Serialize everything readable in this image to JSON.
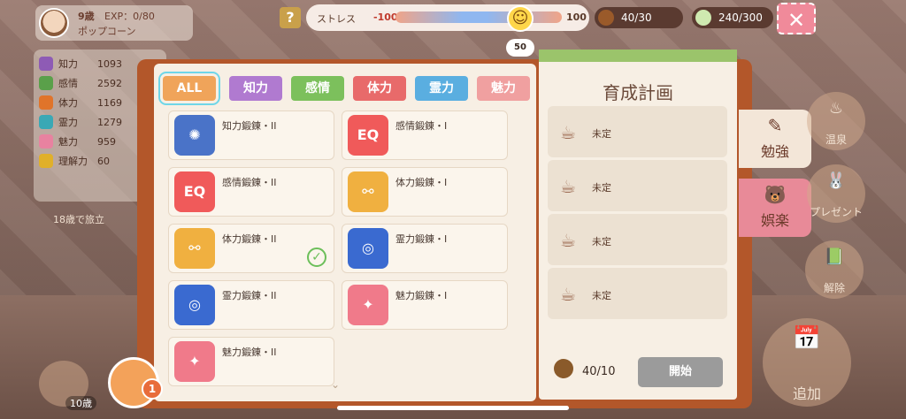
{
  "profile": {
    "age": "9歳",
    "exp": "EXP：0/80",
    "name": "ポップコーン"
  },
  "stats": [
    {
      "label": "知力",
      "value": "1093",
      "color": "#8e5bb5"
    },
    {
      "label": "感情",
      "value": "2592",
      "color": "#5aa04a"
    },
    {
      "label": "体力",
      "value": "1169",
      "color": "#e0742a"
    },
    {
      "label": "霊力",
      "value": "1279",
      "color": "#3aa8b5"
    },
    {
      "label": "魅力",
      "value": "959",
      "color": "#e882a0"
    },
    {
      "label": "理解力",
      "value": "60",
      "color": "#e0b02a"
    }
  ],
  "age_notice": "18歳で旅立",
  "stress": {
    "label": "ストレス",
    "min": "-100",
    "max": "100",
    "value": "50",
    "level": 0.75
  },
  "resources": {
    "acorns": "40/30",
    "energy": "240/300"
  },
  "tabs": [
    {
      "label": "ALL",
      "color": "#f0a45a",
      "selected": true
    },
    {
      "label": "知力",
      "color": "#b07ad0"
    },
    {
      "label": "感情",
      "color": "#7cc05c"
    },
    {
      "label": "体力",
      "color": "#e86a6a"
    },
    {
      "label": "霊力",
      "color": "#5aaee0"
    },
    {
      "label": "魅力",
      "color": "#f0a0a0"
    }
  ],
  "trainings": [
    {
      "title": "知力鍛錬・II",
      "icon": "bulb-icon",
      "color": "#4a73c8",
      "glyph": "✺"
    },
    {
      "title": "感情鍛錬・I",
      "icon": "eq-heart-icon",
      "color": "#f05a5a",
      "glyph": "EQ"
    },
    {
      "title": "感情鍛錬・II",
      "icon": "eq-heart-icon",
      "color": "#f05a5a",
      "glyph": "EQ"
    },
    {
      "title": "体力鍛錬・I",
      "icon": "dumbbell-icon",
      "color": "#f0b040",
      "glyph": "⚯"
    },
    {
      "title": "体力鍛錬・II",
      "icon": "dumbbell-icon",
      "color": "#f0b040",
      "glyph": "⚯",
      "checked": true
    },
    {
      "title": "霊力鍛錬・I",
      "icon": "spiral-icon",
      "color": "#3a6ad0",
      "glyph": "◎"
    },
    {
      "title": "霊力鍛錬・II",
      "icon": "spiral-icon",
      "color": "#3a6ad0",
      "glyph": "◎"
    },
    {
      "title": "魅力鍛錬・I",
      "icon": "lipstick-icon",
      "color": "#f07a8a",
      "glyph": "✦"
    },
    {
      "title": "魅力鍛錬・II",
      "icon": "lipstick-icon",
      "color": "#f07a8a",
      "glyph": "✦"
    }
  ],
  "plan": {
    "title": "育成計画",
    "slots": [
      "未定",
      "未定",
      "未定",
      "未定"
    ],
    "cost": "40/10",
    "start_label": "開始"
  },
  "side_tabs": [
    {
      "label": "勉強",
      "icon": "pencil-icon",
      "bg": "#f3e6d8"
    },
    {
      "label": "娯楽",
      "icon": "bear-icon",
      "bg": "#e88a98"
    }
  ],
  "right_buttons": [
    {
      "label": "温泉",
      "icon": "onsen-icon"
    },
    {
      "label": "プレゼント",
      "icon": "rabbit-icon"
    },
    {
      "label": "解除",
      "icon": "book-icon"
    },
    {
      "label": "追加",
      "icon": "calendar-icon"
    }
  ],
  "mail_badge": "1",
  "notes_count": "10歳"
}
